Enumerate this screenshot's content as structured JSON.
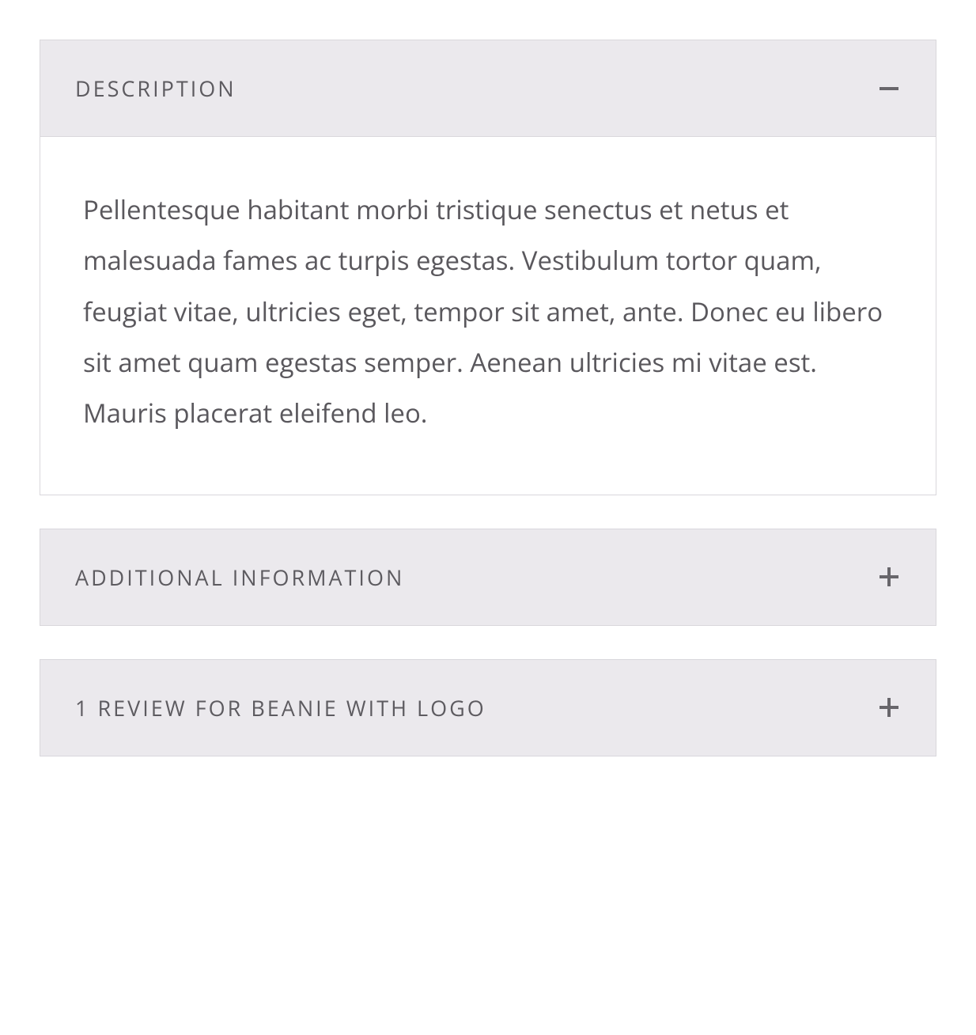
{
  "accordion": {
    "items": [
      {
        "title": "DESCRIPTION",
        "expanded": true,
        "content": "Pellentesque habitant morbi tristique senectus et netus et malesuada fames ac turpis egestas. Vestibulum tortor quam, feugiat vitae, ultricies eget, tempor sit amet, ante. Donec eu libero sit amet quam egestas semper. Aenean ultricies mi vitae est. Mauris placerat eleifend leo."
      },
      {
        "title": "ADDITIONAL INFORMATION",
        "expanded": false
      },
      {
        "title": "1 REVIEW FOR BEANIE WITH LOGO",
        "expanded": false
      }
    ]
  }
}
